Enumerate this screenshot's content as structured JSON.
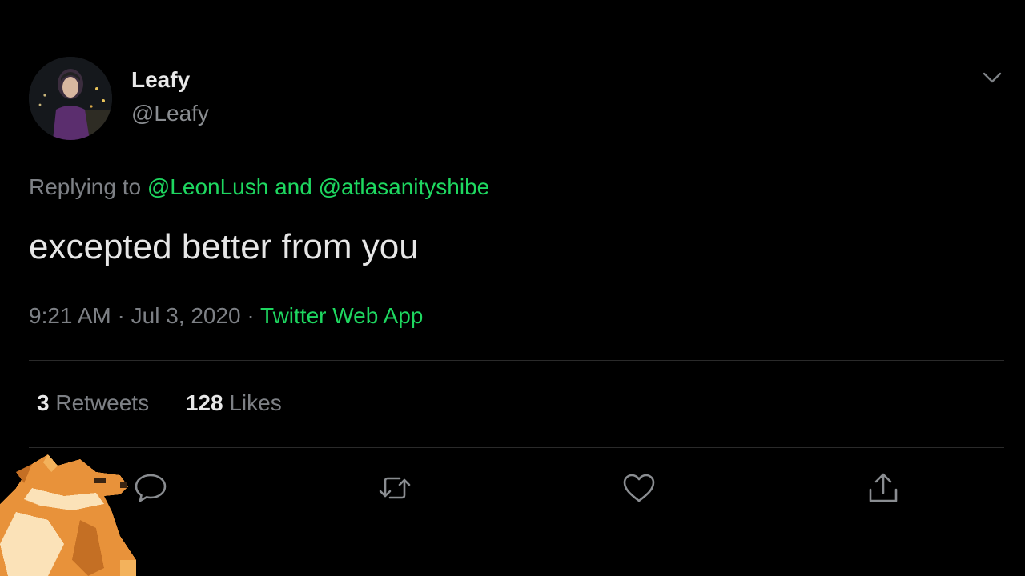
{
  "tweet": {
    "author": {
      "display_name": "Leafy",
      "handle": "@Leafy"
    },
    "reply": {
      "prefix": "Replying to",
      "mention_1": "@LeonLush",
      "conjunction": "and",
      "mention_2": "@atlasanityshibe"
    },
    "text": "excepted better from you",
    "meta": {
      "time": "9:21 AM",
      "separator": "·",
      "date": "Jul 3, 2020",
      "source": "Twitter Web App"
    },
    "stats": {
      "retweets_count": "3",
      "retweets_label": "Retweets",
      "likes_count": "128",
      "likes_label": "Likes"
    },
    "actions": [
      "reply-icon",
      "retweet-icon",
      "like-icon",
      "share-icon"
    ],
    "colors": {
      "accent": "#1ed760",
      "background": "#000000",
      "muted": "#7d8085"
    }
  }
}
